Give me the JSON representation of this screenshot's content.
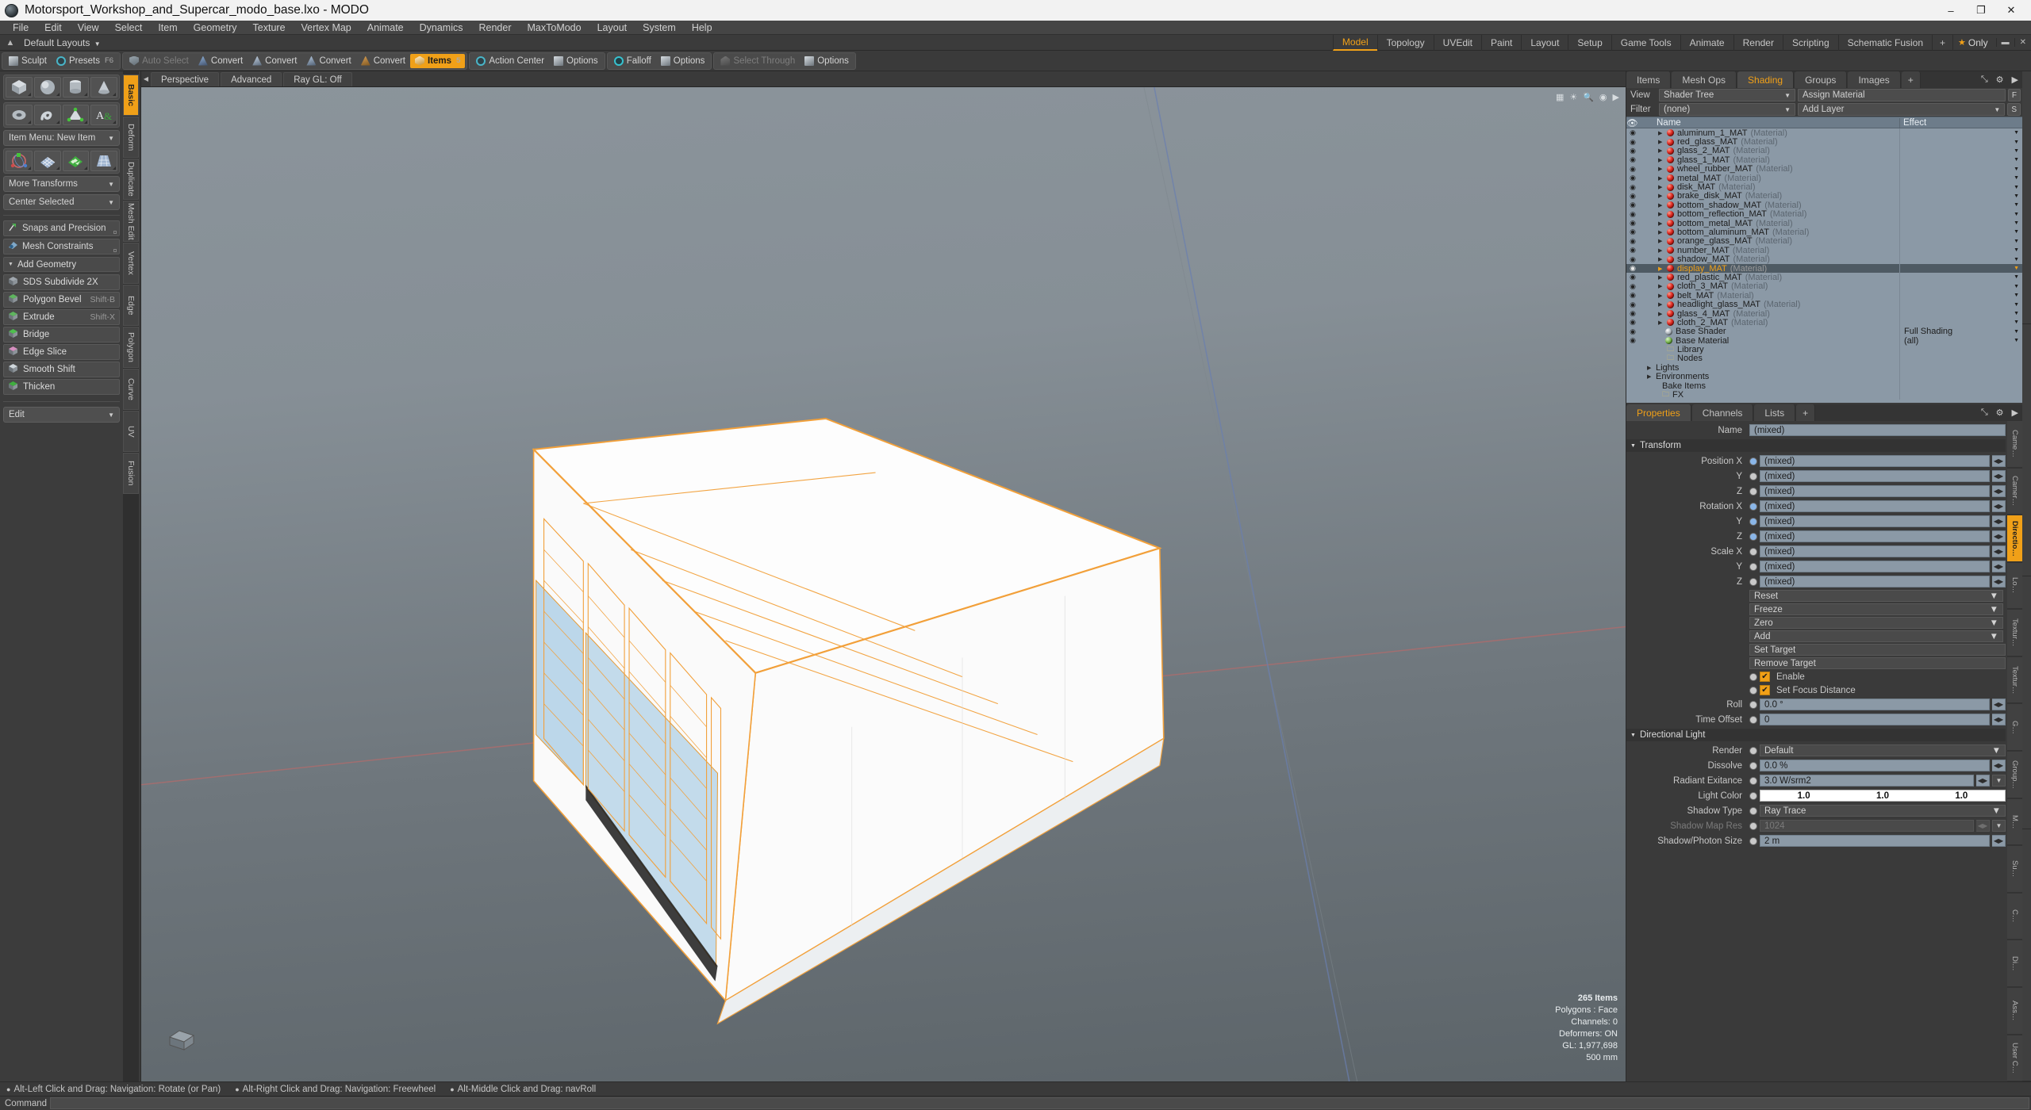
{
  "window": {
    "title": "Motorsport_Workshop_and_Supercar_modo_base.lxo - MODO",
    "minimize": "–",
    "maximize": "❐",
    "close": "✕"
  },
  "menubar": [
    "File",
    "Edit",
    "View",
    "Select",
    "Item",
    "Geometry",
    "Texture",
    "Vertex Map",
    "Animate",
    "Dynamics",
    "Render",
    "MaxToModo",
    "Layout",
    "System",
    "Help"
  ],
  "layout_row": {
    "home_icon": "home-icon",
    "layout_preset": "Default Layouts",
    "tabs": [
      {
        "label": "Model",
        "active": true
      },
      {
        "label": "Topology",
        "active": false
      },
      {
        "label": "UVEdit",
        "active": false
      },
      {
        "label": "Paint",
        "active": false
      },
      {
        "label": "Layout",
        "active": false
      },
      {
        "label": "Setup",
        "active": false
      },
      {
        "label": "Game Tools",
        "active": false
      },
      {
        "label": "Animate",
        "active": false
      },
      {
        "label": "Render",
        "active": false
      },
      {
        "label": "Scripting",
        "active": false
      },
      {
        "label": "Schematic Fusion",
        "active": false
      }
    ],
    "add_tab": "+",
    "only_label": "Only",
    "star": "★"
  },
  "toolbar": {
    "left_group": [
      {
        "label": "Sculpt",
        "icon": "sculpt-icon",
        "active": false,
        "shortcut": ""
      },
      {
        "label": "Presets",
        "icon": "presets-icon",
        "active": false,
        "shortcut": "F6"
      }
    ],
    "selection_group": [
      {
        "label": "Auto Select",
        "icon": "shield-icon",
        "active": false,
        "dim": true,
        "shortcut": ""
      },
      {
        "label": "Convert",
        "icon": "vertex-icon",
        "active": false,
        "dim": false,
        "shortcut": ""
      },
      {
        "label": "Convert",
        "icon": "edge-icon",
        "active": false,
        "dim": false,
        "shortcut": ""
      },
      {
        "label": "Convert",
        "icon": "polygon-icon",
        "active": false,
        "dim": false,
        "shortcut": ""
      },
      {
        "label": "Convert",
        "icon": "material-icon",
        "active": false,
        "dim": false,
        "shortcut": ""
      },
      {
        "label": "Items",
        "icon": "items-icon",
        "active": true,
        "dim": false,
        "shortcut": "5"
      }
    ],
    "action_group": [
      {
        "label": "Action Center",
        "icon": "action-center-icon"
      },
      {
        "label": "Options",
        "icon": "options-icon"
      }
    ],
    "falloff_group": [
      {
        "label": "Falloff",
        "icon": "falloff-icon"
      },
      {
        "label": "Options",
        "icon": "options-icon"
      }
    ],
    "through_group": [
      {
        "label": "Select Through",
        "icon": "select-through-icon",
        "dim": true
      },
      {
        "label": "Options",
        "icon": "options-icon"
      }
    ]
  },
  "left_panel": {
    "primitives_row1": [
      "cube-icon",
      "sphere-icon",
      "cylinder-icon",
      "cone-icon"
    ],
    "primitives_row2": [
      "torus-icon",
      "spiral-icon",
      "mesh-icon",
      "text-icon"
    ],
    "item_menu": "Item Menu: New Item",
    "transform_row": [
      "transform-gizmo-icon",
      "grid-icon",
      "checker-icon",
      "taper-icon"
    ],
    "more_transforms": "More Transforms",
    "center_selected": "Center Selected",
    "snaps": {
      "label": "Snaps and Precision",
      "icon": "snap-icon"
    },
    "constraints": {
      "label": "Mesh Constraints",
      "icon": "constraint-icon"
    },
    "add_geometry_header": "Add Geometry",
    "geometry_ops": [
      {
        "label": "SDS Subdivide 2X",
        "icon": "sds-icon",
        "key": ""
      },
      {
        "label": "Polygon Bevel",
        "icon": "bevel-icon",
        "key": "Shift-B"
      },
      {
        "label": "Extrude",
        "icon": "extrude-icon",
        "key": "Shift-X"
      },
      {
        "label": "Bridge",
        "icon": "bridge-icon",
        "key": ""
      },
      {
        "label": "Edge Slice",
        "icon": "edge-slice-icon",
        "key": ""
      },
      {
        "label": "Smooth Shift",
        "icon": "smooth-shift-icon",
        "key": ""
      },
      {
        "label": "Thicken",
        "icon": "thicken-icon",
        "key": ""
      }
    ],
    "edit_dropdown": "Edit",
    "vertical_tabs": [
      {
        "label": "Basic",
        "active": true
      },
      {
        "label": "Deform",
        "active": false
      },
      {
        "label": "Duplicate",
        "active": false
      },
      {
        "label": "Mesh Edit",
        "active": false
      },
      {
        "label": "Vertex",
        "active": false
      },
      {
        "label": "Edge",
        "active": false
      },
      {
        "label": "Polygon",
        "active": false
      },
      {
        "label": "Curve",
        "active": false
      },
      {
        "label": "UV",
        "active": false
      },
      {
        "label": "Fusion",
        "active": false
      }
    ]
  },
  "viewport": {
    "tabs": [
      {
        "label": "Perspective",
        "active": true
      },
      {
        "label": "Advanced",
        "active": false
      },
      {
        "label": "Ray GL: Off",
        "active": false
      }
    ],
    "top_icons": [
      "grid-icon",
      "light-icon",
      "search-icon",
      "camera-icon",
      "chevron-right-icon"
    ],
    "stats": {
      "items": "265 Items",
      "polygons": "Polygons : Face",
      "channels": "Channels: 0",
      "deformers": "Deformers: ON",
      "gl": "GL: 1,977,698",
      "scale": "500 mm"
    },
    "gizmo": "axis-gizmo"
  },
  "shading_panel": {
    "tabs": [
      {
        "label": "Items",
        "active": false
      },
      {
        "label": "Mesh Ops",
        "active": false
      },
      {
        "label": "Shading",
        "active": true
      },
      {
        "label": "Groups",
        "active": false
      },
      {
        "label": "Images",
        "active": false
      },
      {
        "label": "+",
        "active": false
      }
    ],
    "view_label": "View",
    "view_value": "Shader Tree",
    "assign_material": "Assign Material",
    "assign_btn": "F",
    "filter_label": "Filter",
    "filter_value": "(none)",
    "add_layer": "Add Layer",
    "add_layer_btn": "S",
    "columns": {
      "name": "Name",
      "effect": "Effect"
    },
    "materials": [
      {
        "name": "aluminum_1_MAT",
        "type": "(Material)",
        "effect": "",
        "selected": false
      },
      {
        "name": "red_glass_MAT",
        "type": "(Material)",
        "effect": "",
        "selected": false
      },
      {
        "name": "glass_2_MAT",
        "type": "(Material)",
        "effect": "",
        "selected": false
      },
      {
        "name": "glass_1_MAT",
        "type": "(Material)",
        "effect": "",
        "selected": false
      },
      {
        "name": "wheel_rubber_MAT",
        "type": "(Material)",
        "effect": "",
        "selected": false
      },
      {
        "name": "metal_MAT",
        "type": "(Material)",
        "effect": "",
        "selected": false
      },
      {
        "name": "disk_MAT",
        "type": "(Material)",
        "effect": "",
        "selected": false
      },
      {
        "name": "brake_disk_MAT",
        "type": "(Material)",
        "effect": "",
        "selected": false
      },
      {
        "name": "bottom_shadow_MAT",
        "type": "(Material)",
        "effect": "",
        "selected": false
      },
      {
        "name": "bottom_reflection_MAT",
        "type": "(Material)",
        "effect": "",
        "selected": false
      },
      {
        "name": "bottom_metal_MAT",
        "type": "(Material)",
        "effect": "",
        "selected": false
      },
      {
        "name": "bottom_aluminum_MAT",
        "type": "(Material)",
        "effect": "",
        "selected": false
      },
      {
        "name": "orange_glass_MAT",
        "type": "(Material)",
        "effect": "",
        "selected": false
      },
      {
        "name": "number_MAT",
        "type": "(Material)",
        "effect": "",
        "selected": false
      },
      {
        "name": "shadow_MAT",
        "type": "(Material)",
        "effect": "",
        "selected": false
      },
      {
        "name": "display_MAT",
        "type": "(Material)",
        "effect": "",
        "selected": true
      },
      {
        "name": "red_plastic_MAT",
        "type": "(Material)",
        "effect": "",
        "selected": false
      },
      {
        "name": "cloth_3_MAT",
        "type": "(Material)",
        "effect": "",
        "selected": false
      },
      {
        "name": "belt_MAT",
        "type": "(Material)",
        "effect": "",
        "selected": false
      },
      {
        "name": "headlight_glass_MAT",
        "type": "(Material)",
        "effect": "",
        "selected": false
      },
      {
        "name": "glass_4_MAT",
        "type": "(Material)",
        "effect": "",
        "selected": false
      },
      {
        "name": "cloth_2_MAT",
        "type": "(Material)",
        "effect": "",
        "selected": false
      }
    ],
    "shaders": [
      {
        "name": "Base Shader",
        "effect": "Full Shading",
        "ball": "grey"
      },
      {
        "name": "Base Material",
        "effect": "(all)",
        "ball": "green"
      }
    ],
    "folders": [
      "Library",
      "Nodes"
    ],
    "groups": [
      "Lights",
      "Environments"
    ],
    "bake_items": "Bake Items",
    "fx": "FX"
  },
  "properties_panel": {
    "tabs": [
      {
        "label": "Properties",
        "active": true
      },
      {
        "label": "Channels",
        "active": false
      },
      {
        "label": "Lists",
        "active": false
      },
      {
        "label": "+",
        "active": false
      }
    ],
    "name_label": "Name",
    "name_value": "(mixed)",
    "transform_header": "Transform",
    "transform_rows": [
      {
        "label": "Position X",
        "value": "(mixed)",
        "dot": "blue"
      },
      {
        "label": "Y",
        "value": "(mixed)",
        "dot": "grey"
      },
      {
        "label": "Z",
        "value": "(mixed)",
        "dot": "grey"
      },
      {
        "label": "Rotation X",
        "value": "(mixed)",
        "dot": "blue"
      },
      {
        "label": "Y",
        "value": "(mixed)",
        "dot": "blue"
      },
      {
        "label": "Z",
        "value": "(mixed)",
        "dot": "blue"
      },
      {
        "label": "Scale X",
        "value": "(mixed)",
        "dot": "grey"
      },
      {
        "label": "Y",
        "value": "(mixed)",
        "dot": "grey"
      },
      {
        "label": "Z",
        "value": "(mixed)",
        "dot": "grey"
      }
    ],
    "dropdowns": [
      "Reset",
      "Freeze",
      "Zero",
      "Add"
    ],
    "buttons": [
      "Set Target",
      "Remove Target"
    ],
    "checkboxes": [
      {
        "label": "Enable",
        "checked": true
      },
      {
        "label": "Set Focus Distance",
        "checked": true
      }
    ],
    "roll": {
      "label": "Roll",
      "value": "0.0 °"
    },
    "time_offset": {
      "label": "Time Offset",
      "value": "0"
    },
    "light_header": "Directional Light",
    "light_rows": [
      {
        "label": "Render",
        "value": "Default",
        "kind": "dropdown",
        "disabled": false
      },
      {
        "label": "Dissolve",
        "value": "0.0 %",
        "kind": "spin",
        "disabled": false
      },
      {
        "label": "Radiant Exitance",
        "value": "3.0 W/srm2",
        "kind": "spin-dd",
        "disabled": false
      },
      {
        "label": "Light Color",
        "value": [
          "1.0",
          "1.0",
          "1.0"
        ],
        "kind": "color",
        "disabled": false
      },
      {
        "label": "Shadow Type",
        "value": "Ray Trace",
        "kind": "dropdown",
        "disabled": false
      },
      {
        "label": "Shadow Map Res",
        "value": "1024",
        "kind": "spin-dd",
        "disabled": true
      },
      {
        "label": "Shadow/Photon Size",
        "value": "2 m",
        "kind": "spin",
        "disabled": false
      }
    ],
    "vertical_tabs": [
      {
        "label": "Came…",
        "active": false
      },
      {
        "label": "Camer…",
        "active": false
      },
      {
        "label": "Directio…",
        "active": true
      },
      {
        "label": "Lo…",
        "active": false
      },
      {
        "label": "Textur…",
        "active": false
      },
      {
        "label": "Textur…",
        "active": false
      },
      {
        "label": "G…",
        "active": false
      },
      {
        "label": "Group…",
        "active": false
      },
      {
        "label": "M…",
        "active": false
      },
      {
        "label": "Su…",
        "active": false
      },
      {
        "label": "C…",
        "active": false
      },
      {
        "label": "Di…",
        "active": false
      },
      {
        "label": "Ass…",
        "active": false
      },
      {
        "label": "User C…",
        "active": false
      }
    ]
  },
  "statusbar": {
    "hints": [
      "Alt-Left Click and Drag: Navigation: Rotate (or Pan)",
      "Alt-Right Click and Drag: Navigation: Freewheel",
      "Alt-Middle Click and Drag: navRoll"
    ]
  },
  "commandbar": {
    "label": "Command",
    "value": ""
  }
}
